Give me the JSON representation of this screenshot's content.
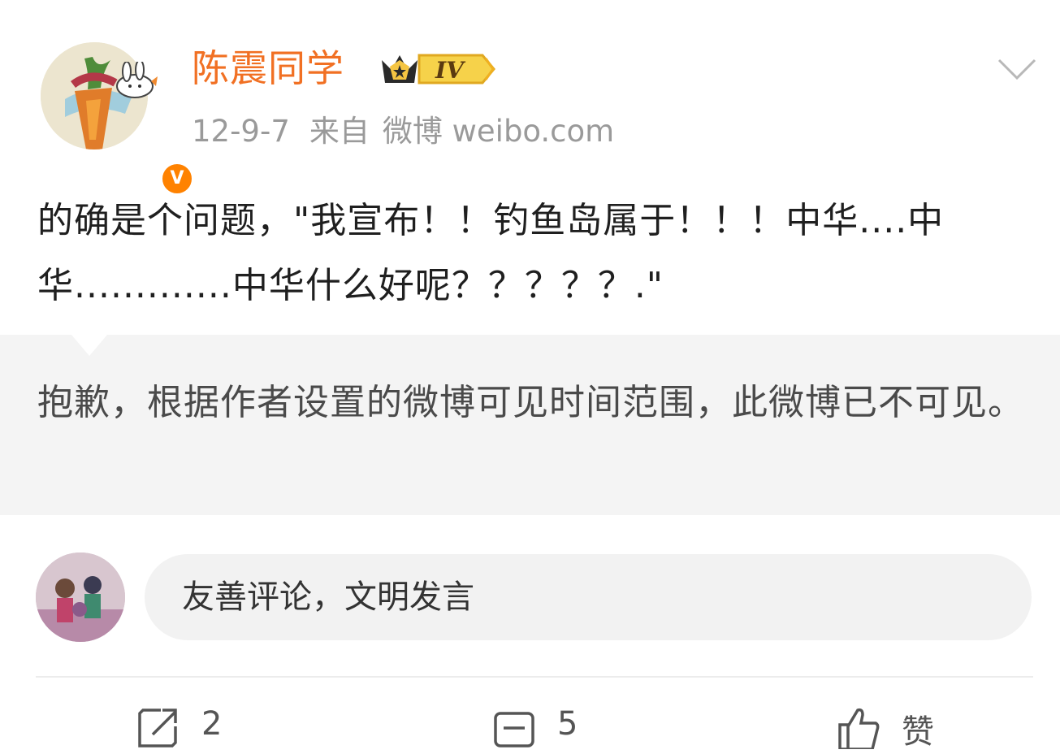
{
  "post": {
    "username": "陈震同学",
    "level_badge": "IV",
    "verified_badge": "V",
    "date": "12-9-7",
    "source_prefix": "来自",
    "source": "微博 weibo.com",
    "text": "的确是个问题，\"我宣布！！钓鱼岛属于！！！中华....中华.............中华什么好呢？？？？？.\""
  },
  "notice": {
    "message": "抱歉，根据作者设置的微博可见时间范围，此微博已不可见。"
  },
  "comment_box": {
    "placeholder": "友善评论，文明发言"
  },
  "actions": {
    "repost_count": "2",
    "comment_count": "5",
    "like_label": "赞"
  },
  "icons": {
    "more": "chevron-down-icon",
    "crown": "crown-icon",
    "repost": "repost-icon",
    "comment": "comment-icon",
    "like": "thumbs-up-icon"
  },
  "colors": {
    "username": "#f17023",
    "verified": "#ff8200",
    "meta_text": "#9a9a9a",
    "notice_bg": "#f4f4f4"
  }
}
